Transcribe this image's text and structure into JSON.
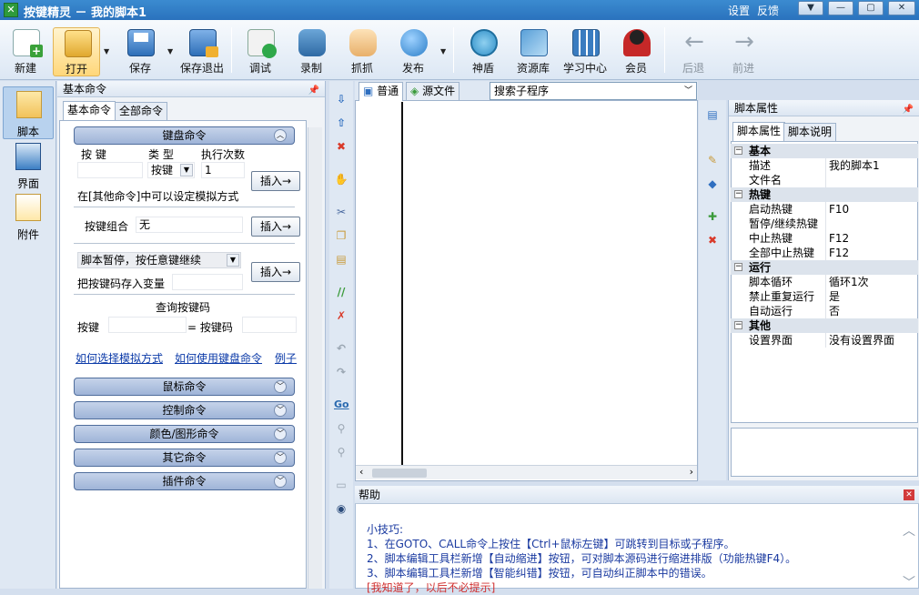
{
  "window": {
    "title": "按键精灵 － 我的脚本1",
    "links": [
      "设置",
      "反馈"
    ],
    "controls": [
      "▼",
      "—",
      "▢",
      "✕"
    ]
  },
  "toolbar": {
    "items": [
      {
        "label": "新建",
        "icon": "new-doc-icon"
      },
      {
        "label": "打开",
        "icon": "open-folder-icon"
      },
      {
        "label": "保存",
        "icon": "save-icon"
      },
      {
        "label": "保存退出",
        "icon": "save-exit-icon"
      },
      {
        "label": "调试",
        "icon": "debug-icon"
      },
      {
        "label": "录制",
        "icon": "record-camera-icon"
      },
      {
        "label": "抓抓",
        "icon": "grab-hand-icon"
      },
      {
        "label": "发布",
        "icon": "publish-globe-icon"
      },
      {
        "label": "神盾",
        "icon": "shield-icon"
      },
      {
        "label": "资源库",
        "icon": "resource-icon"
      },
      {
        "label": "学习中心",
        "icon": "learn-icon"
      },
      {
        "label": "会员",
        "icon": "member-icon"
      },
      {
        "label": "后退",
        "icon": "back-arrow-icon"
      },
      {
        "label": "前进",
        "icon": "forward-arrow-icon"
      }
    ]
  },
  "leftnav": [
    {
      "label": "脚本"
    },
    {
      "label": "界面"
    },
    {
      "label": "附件"
    }
  ],
  "cmdpanel": {
    "title": "基本命令",
    "tabs": [
      "基本命令",
      "全部命令"
    ],
    "keyboard": {
      "group": "键盘命令",
      "col_key": "按 键",
      "col_type": "类 型",
      "col_count": "执行次数",
      "type_value": "按键",
      "count_value": "1",
      "insert": "插入→",
      "note": "在[其他命令]中可以设定模拟方式",
      "combo_label": "按键组合",
      "combo_value": "无",
      "pause_value": "脚本暂停，按任意键继续",
      "store_label": "把按键码存入变量",
      "query_title": "查询按键码",
      "query_key": "按键",
      "query_code": "= 按键码"
    },
    "links": [
      "如何选择模拟方式",
      "如何使用键盘命令",
      "例子"
    ],
    "groups": [
      "鼠标命令",
      "控制命令",
      "颜色/图形命令",
      "其它命令",
      "插件命令"
    ]
  },
  "editor": {
    "tabs": [
      "普通",
      "源文件"
    ],
    "search_placeholder": "搜索子程序"
  },
  "props": {
    "title": "脚本属性",
    "tabs": [
      "脚本属性",
      "脚本说明"
    ],
    "rows": [
      {
        "cat": "基本"
      },
      {
        "k": "描述",
        "v": "我的脚本1"
      },
      {
        "k": "文件名",
        "v": ""
      },
      {
        "cat": "热键"
      },
      {
        "k": "启动热键",
        "v": "F10"
      },
      {
        "k": "暂停/继续热键",
        "v": ""
      },
      {
        "k": "中止热键",
        "v": "F12"
      },
      {
        "k": "全部中止热键",
        "v": "F12"
      },
      {
        "cat": "运行"
      },
      {
        "k": "脚本循环",
        "v": "循环1次"
      },
      {
        "k": "禁止重复运行",
        "v": "是"
      },
      {
        "k": "自动运行",
        "v": "否"
      },
      {
        "cat": "其他"
      },
      {
        "k": "设置界面",
        "v": "没有设置界面"
      }
    ]
  },
  "help": {
    "title": "帮助",
    "lines": [
      "小技巧:",
      "1、在GOTO、CALL命令上按住【Ctrl+鼠标左键】可跳转到目标或子程序。",
      "2、脚本编辑工具栏新增【自动缩进】按钮，可对脚本源码进行缩进排版（功能热键F4）。",
      "3、脚本编辑工具栏新增【智能纠错】按钮，可自动纠正脚本中的错误。",
      "[我知道了，以后不必提示]"
    ]
  }
}
